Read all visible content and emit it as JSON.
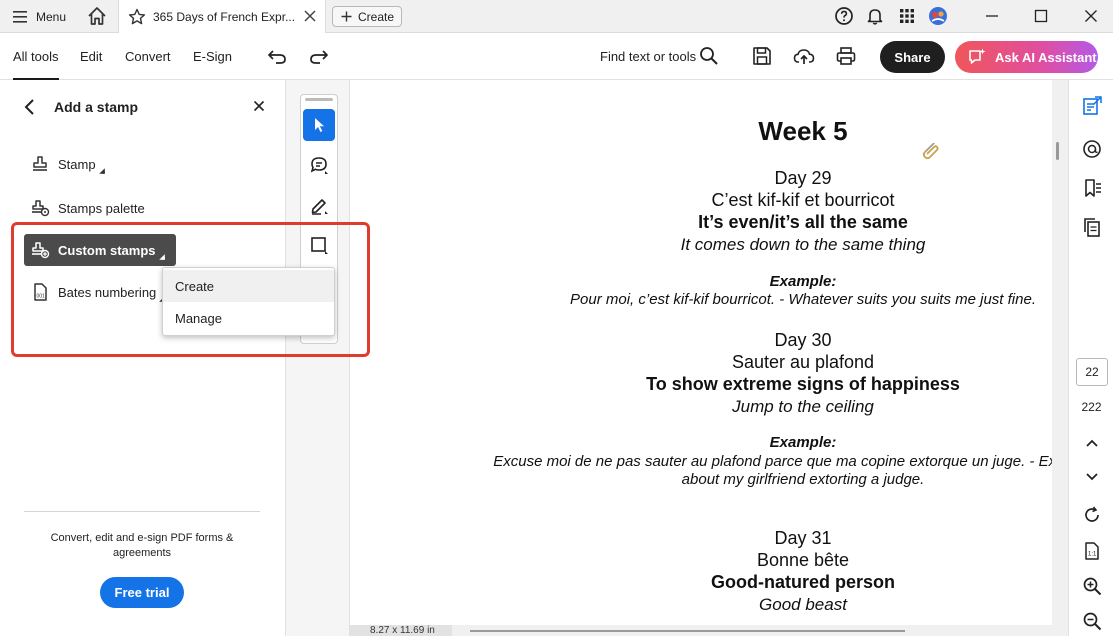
{
  "titlebar": {
    "menu_label": "Menu",
    "tab_title": "365 Days of French Expr...",
    "create_label": "Create",
    "icons": [
      "help-icon",
      "bell-icon",
      "apps-grid-icon",
      "avatar",
      "minimize-icon",
      "maximize-icon",
      "close-icon"
    ]
  },
  "toolbar": {
    "tabs": [
      "All tools",
      "Edit",
      "Convert",
      "E-Sign"
    ],
    "active_tab": "All tools",
    "find_label": "Find text or tools",
    "share_label": "Share",
    "ai_label": "Ask AI Assistant"
  },
  "left_panel": {
    "title": "Add a stamp",
    "items": [
      {
        "label": "Stamp",
        "icon": "stamp-icon"
      },
      {
        "label": "Stamps palette",
        "icon": "stamps-palette-icon"
      },
      {
        "label": "Custom stamps",
        "icon": "custom-stamps-icon",
        "selected": true
      },
      {
        "label": "Bates numbering",
        "icon": "bates-numbering-icon"
      }
    ],
    "promo_text": "Convert, edit and e-sign PDF forms & agreements",
    "trial_label": "Free trial"
  },
  "dropdown": {
    "items": [
      "Create",
      "Manage"
    ]
  },
  "document": {
    "lines": [
      {
        "text": "Week 5",
        "style": "h1"
      },
      {
        "text": "Day 29",
        "style": "day"
      },
      {
        "text": "C’est kif-kif et bourricot",
        "style": "fr"
      },
      {
        "text": "It’s even/it’s all the same",
        "style": "en"
      },
      {
        "text": "It comes down to the same thing",
        "style": "lit"
      },
      {
        "text": "Example:",
        "style": "exl"
      },
      {
        "text": "Pour moi, c’est kif-kif bourricot. - Whatever suits you suits me just fine.",
        "style": "ex"
      },
      {
        "text": "Day 30",
        "style": "day"
      },
      {
        "text": "Sauter au plafond",
        "style": "fr"
      },
      {
        "text": "To show extreme signs of happiness",
        "style": "en"
      },
      {
        "text": "Jump to the ceiling",
        "style": "lit"
      },
      {
        "text": "Example:",
        "style": "exl"
      },
      {
        "text": "Excuse moi de ne pas sauter au plafond parce que ma copine extorque un juge. - Excuse me",
        "style": "ex"
      },
      {
        "text": "about my girlfriend extorting a judge.",
        "style": "ex"
      },
      {
        "text": "Day 31",
        "style": "day"
      },
      {
        "text": "Bonne bête",
        "style": "fr"
      },
      {
        "text": "Good-natured person",
        "style": "en"
      },
      {
        "text": "Good beast",
        "style": "lit"
      }
    ],
    "page_size": "8.27 x 11.69 in"
  },
  "right_rail": {
    "current_page": "22",
    "total_pages": "222"
  },
  "colors": {
    "accent": "#1473e6",
    "highlight": "#e03c2d",
    "selected_item": "#4b4b4b",
    "share": "#1f1f1f"
  }
}
